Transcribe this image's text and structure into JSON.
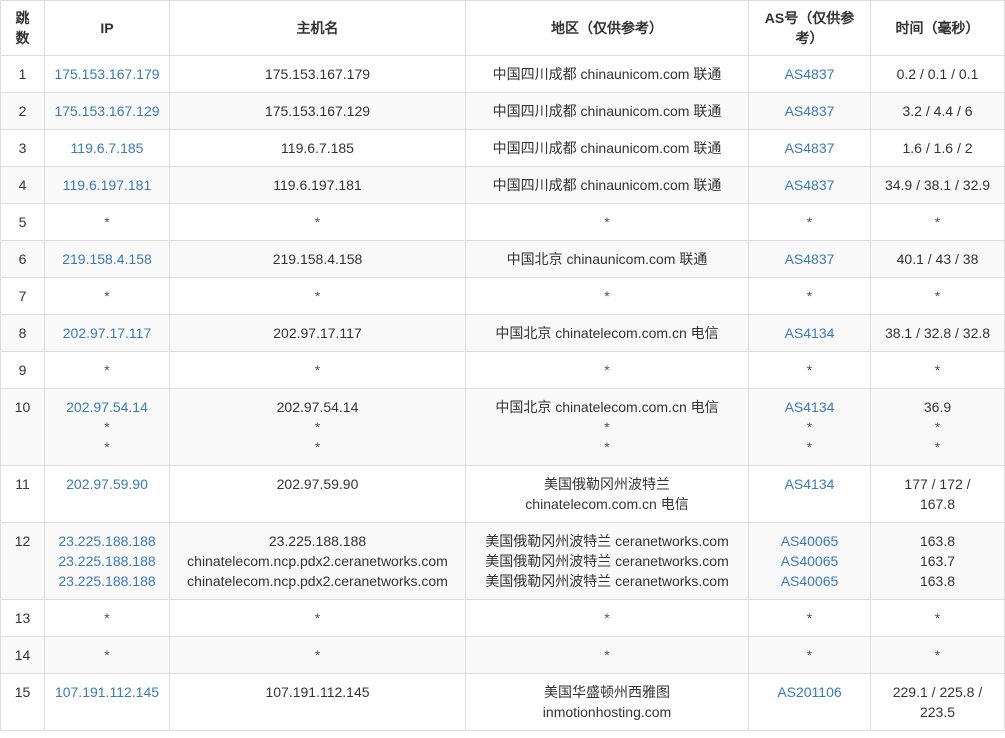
{
  "headers": {
    "hop": "跳数",
    "ip": "IP",
    "hostname": "主机名",
    "region": "地区（仅供参考）",
    "as": "AS号（仅供参考）",
    "time": "时间（毫秒）"
  },
  "rows": [
    {
      "hop": "1",
      "ip": [
        "175.153.167.179"
      ],
      "host": [
        "175.153.167.179"
      ],
      "region": [
        "中国四川成都 chinaunicom.com 联通"
      ],
      "as": [
        "AS4837"
      ],
      "time": [
        "0.2 / 0.1 / 0.1"
      ]
    },
    {
      "hop": "2",
      "ip": [
        "175.153.167.129"
      ],
      "host": [
        "175.153.167.129"
      ],
      "region": [
        "中国四川成都 chinaunicom.com 联通"
      ],
      "as": [
        "AS4837"
      ],
      "time": [
        "3.2 / 4.4 / 6"
      ]
    },
    {
      "hop": "3",
      "ip": [
        "119.6.7.185"
      ],
      "host": [
        "119.6.7.185"
      ],
      "region": [
        "中国四川成都 chinaunicom.com 联通"
      ],
      "as": [
        "AS4837"
      ],
      "time": [
        "1.6 / 1.6 / 2"
      ]
    },
    {
      "hop": "4",
      "ip": [
        "119.6.197.181"
      ],
      "host": [
        "119.6.197.181"
      ],
      "region": [
        "中国四川成都 chinaunicom.com 联通"
      ],
      "as": [
        "AS4837"
      ],
      "time": [
        "34.9 / 38.1 / 32.9"
      ]
    },
    {
      "hop": "5",
      "ip": [
        "*"
      ],
      "host": [
        "*"
      ],
      "region": [
        "*"
      ],
      "as": [
        "*"
      ],
      "time": [
        "*"
      ]
    },
    {
      "hop": "6",
      "ip": [
        "219.158.4.158"
      ],
      "host": [
        "219.158.4.158"
      ],
      "region": [
        "中国北京 chinaunicom.com 联通"
      ],
      "as": [
        "AS4837"
      ],
      "time": [
        "40.1 / 43 / 38"
      ]
    },
    {
      "hop": "7",
      "ip": [
        "*"
      ],
      "host": [
        "*"
      ],
      "region": [
        "*"
      ],
      "as": [
        "*"
      ],
      "time": [
        "*"
      ]
    },
    {
      "hop": "8",
      "ip": [
        "202.97.17.117"
      ],
      "host": [
        "202.97.17.117"
      ],
      "region": [
        "中国北京 chinatelecom.com.cn 电信"
      ],
      "as": [
        "AS4134"
      ],
      "time": [
        "38.1 / 32.8 / 32.8"
      ]
    },
    {
      "hop": "9",
      "ip": [
        "*"
      ],
      "host": [
        "*"
      ],
      "region": [
        "*"
      ],
      "as": [
        "*"
      ],
      "time": [
        "*"
      ]
    },
    {
      "hop": "10",
      "ip": [
        "202.97.54.14",
        "*",
        "*"
      ],
      "host": [
        "202.97.54.14",
        "*",
        "*"
      ],
      "region": [
        "中国北京 chinatelecom.com.cn 电信",
        "*",
        "*"
      ],
      "as": [
        "AS4134",
        "*",
        "*"
      ],
      "time": [
        "36.9",
        "*",
        "*"
      ]
    },
    {
      "hop": "11",
      "ip": [
        "202.97.59.90"
      ],
      "host": [
        "202.97.59.90"
      ],
      "region": [
        "美国俄勒冈州波特兰",
        "chinatelecom.com.cn 电信"
      ],
      "as": [
        "AS4134"
      ],
      "time": [
        "177 / 172 /",
        "167.8"
      ]
    },
    {
      "hop": "12",
      "ip": [
        "23.225.188.188",
        "23.225.188.188",
        "23.225.188.188"
      ],
      "host": [
        "23.225.188.188",
        "chinatelecom.ncp.pdx2.ceranetworks.com",
        "chinatelecom.ncp.pdx2.ceranetworks.com"
      ],
      "region": [
        "美国俄勒冈州波特兰 ceranetworks.com",
        "美国俄勒冈州波特兰 ceranetworks.com",
        "美国俄勒冈州波特兰 ceranetworks.com"
      ],
      "as": [
        "AS40065",
        "AS40065",
        "AS40065"
      ],
      "time": [
        "163.8",
        "163.7",
        "163.8"
      ]
    },
    {
      "hop": "13",
      "ip": [
        "*"
      ],
      "host": [
        "*"
      ],
      "region": [
        "*"
      ],
      "as": [
        "*"
      ],
      "time": [
        "*"
      ]
    },
    {
      "hop": "14",
      "ip": [
        "*"
      ],
      "host": [
        "*"
      ],
      "region": [
        "*"
      ],
      "as": [
        "*"
      ],
      "time": [
        "*"
      ]
    },
    {
      "hop": "15",
      "ip": [
        "107.191.112.145"
      ],
      "host": [
        "107.191.112.145"
      ],
      "region": [
        "美国华盛顿州西雅图",
        "inmotionhosting.com"
      ],
      "as": [
        "AS201106"
      ],
      "time": [
        "229.1 / 225.8 /",
        "223.5"
      ]
    }
  ],
  "colors": {
    "link": "#3a7ab8",
    "border": "#dddddd",
    "zebra": "#f9f9f9"
  }
}
